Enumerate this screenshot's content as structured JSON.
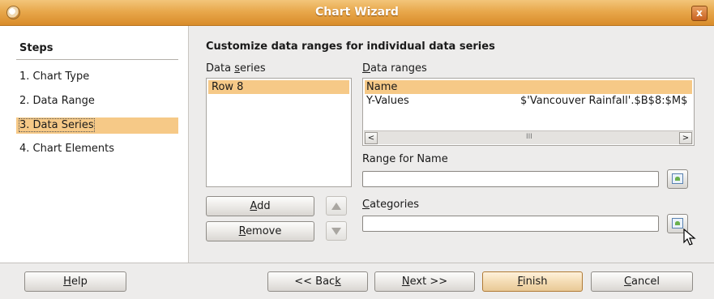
{
  "window": {
    "title": "Chart Wizard",
    "close_symbol": "x"
  },
  "steps": {
    "header": "Steps",
    "items": [
      {
        "label": "1. Chart Type"
      },
      {
        "label": "2. Data Range"
      },
      {
        "label": "3. Data Series"
      },
      {
        "label": "4. Chart Elements"
      }
    ],
    "active_index": 2
  },
  "main": {
    "title": "Customize data ranges for individual data series",
    "data_series": {
      "label_pre": "Data ",
      "label_ul": "s",
      "label_post": "eries",
      "items": [
        "Row 8"
      ]
    },
    "data_ranges": {
      "label_ul": "D",
      "label_post": "ata ranges",
      "rows": [
        {
          "role": "Name",
          "range": ""
        },
        {
          "role": "Y-Values",
          "range": "$'Vancouver Rainfall'.$B$8:$M$"
        }
      ],
      "scroll_left": "<",
      "scroll_right": ">",
      "scroll_grip": "III"
    },
    "range_for_name": {
      "label": "Range for Name",
      "value": ""
    },
    "categories": {
      "label_ul": "C",
      "label_post": "ategories",
      "value": ""
    },
    "add_button": {
      "ul": "A",
      "post": "dd"
    },
    "remove_button": {
      "ul": "R",
      "post": "emove"
    }
  },
  "footer": {
    "help": {
      "ul": "H",
      "post": "elp"
    },
    "back": {
      "pre": "<< Bac",
      "ul": "k"
    },
    "next": {
      "ul": "N",
      "post": "ext >>"
    },
    "finish": {
      "ul": "F",
      "post": "inish"
    },
    "cancel": {
      "ul": "C",
      "post": "ancel"
    }
  },
  "colors": {
    "title_bar": "#e8a84c",
    "selection": "#f6c987",
    "window_bg": "#edeceb"
  },
  "icons": [
    "window-menu-icon",
    "close-icon",
    "arrow-up-icon",
    "arrow-down-icon",
    "range-picker-icon",
    "mouse-cursor-icon"
  ]
}
